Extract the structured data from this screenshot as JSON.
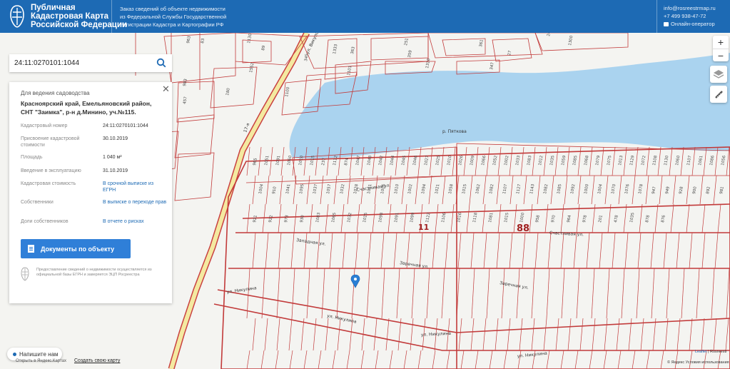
{
  "header": {
    "title": "Публичная\nКадастровая Карта\nРоссийской Федерации",
    "info": "Заказ сведений об объекте недвижимости\nиз Федеральной Службы Государственной\nРегистрации Кадастра и Картографии РФ",
    "email": "info@rosreestrmap.ru",
    "phone": "+7 499 938-47-72",
    "chat_operator": "Онлайн-оператор"
  },
  "search": {
    "value": "24:11:0270101:1044"
  },
  "panel": {
    "purpose": "Для ведения садоводства",
    "address": "Красноярский край, Емельяновский район, СНТ \"Заимка\", р-н д.Минино, уч.№115.",
    "rows": [
      {
        "key": "Кадастровый номер",
        "value": "24:11:0270101:1044"
      },
      {
        "key": "Присвоение кадастровой стоимости",
        "value": "30.10.2019"
      },
      {
        "key": "Площадь",
        "value": "1 040 м²"
      },
      {
        "key": "Введение в эксплуатацию",
        "value": "31.10.2019"
      },
      {
        "key": "Кадастровая стоимость",
        "value": "В срочной выписке из ЕГРН"
      },
      {
        "key": "Собственники",
        "value": "В выписке о переходе прав"
      },
      {
        "key": "Доли собственников",
        "value": "В отчете о рисках"
      }
    ],
    "button": "Документы по объекту",
    "note": "Предоставление сведений о недвижимости осуществляется из официальной базы ЕГРН и заверяется ЭЦП Росреестра"
  },
  "map": {
    "river_label": "р. Пяткова",
    "street_vikulina": "ул. Никулина",
    "street_vikulina2": "ул. Никулина",
    "street_vikulina3": "ул. Никулина",
    "street_vikulina4": "ул. Никулина",
    "street_zapadnaya": "Западная ул.",
    "street_zarechnaya": "Заречная ул.",
    "street_zarechnaya2": "Заречная ул.",
    "street_schastlivaya": "Счастливая ул.",
    "street_schastlivaya2": "Счастливая ул.",
    "street_vikulovo": "ул. Викулова",
    "quarter_11": "11",
    "quarter_88": "88",
    "road_label": "17-я",
    "plots": [
      "457",
      "983",
      "1101",
      "1100",
      "180",
      "1552",
      "347",
      "1310",
      "1300",
      "2407",
      "27",
      "361",
      "363",
      "1333",
      "345",
      "359",
      "251",
      "83",
      "963",
      "89",
      "1130",
      "965",
      "1051",
      "1091",
      "1060",
      "1010",
      "1015",
      "237",
      "1112",
      "874",
      "1047",
      "1048",
      "1042",
      "1044",
      "1045",
      "1046",
      "1027",
      "1025",
      "1010",
      "1026",
      "1009",
      "1066",
      "1052",
      "1002",
      "1033",
      "1083",
      "1012",
      "1035",
      "1059",
      "1085",
      "1068",
      "1079",
      "1075",
      "1013",
      "1129",
      "1072",
      "1108",
      "1130",
      "1060",
      "1107",
      "1061",
      "1086",
      "1056",
      "1004",
      "910",
      "1041",
      "1095",
      "1037",
      "1057",
      "1032",
      "1028",
      "1061",
      "1006",
      "1010",
      "1002",
      "1094",
      "1021",
      "1058",
      "1015",
      "1062",
      "1082",
      "1107",
      "1127",
      "1143",
      "1082",
      "1085",
      "1092",
      "1000",
      "1004",
      "1070",
      "1076",
      "1078",
      "947",
      "949",
      "928",
      "900",
      "892",
      "981",
      "921",
      "922",
      "973",
      "930",
      "1083",
      "1065",
      "1032",
      "1015",
      "1098",
      "1091",
      "1099",
      "1122",
      "1106",
      "1016",
      "1118",
      "1081",
      "1015",
      "1000",
      "958",
      "970",
      "964",
      "978",
      "201",
      "478",
      "1035",
      "878",
      "876"
    ]
  },
  "controls": {
    "zoom_in": "+",
    "zoom_out": "−"
  },
  "footer": {
    "chat": "Напишите нам",
    "yandex": "Открыть в Яндекс.Картах",
    "create_map": "Создать свою карту",
    "leaflet": "Leaflet",
    "leaflet_rest": "| Rosreestr",
    "terms": "© Яндекс Условия использования"
  }
}
